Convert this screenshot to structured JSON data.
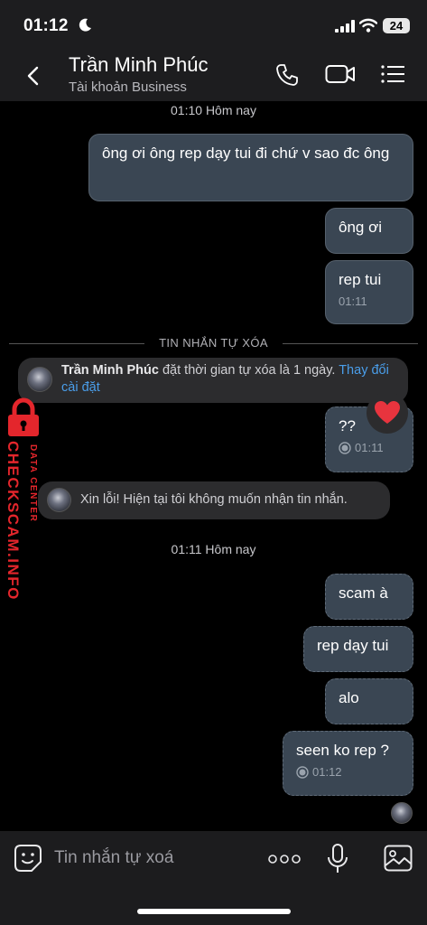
{
  "status_bar": {
    "time": "01:12",
    "battery": "24"
  },
  "header": {
    "contact_name": "Trần Minh Phúc",
    "contact_subtitle": "Tài khoản Business",
    "icons": [
      "back-icon",
      "phone-icon",
      "video-call-icon",
      "menu-icon"
    ]
  },
  "chat": {
    "timestamp_1": "01:10 Hôm nay",
    "messages_1": [
      {
        "text": "ông ơi ông rep dạy tui đi chứ v sao đc ông"
      },
      {
        "text": "ông ơi"
      },
      {
        "text": "rep tui",
        "time": "01:11"
      }
    ],
    "divider_label": "TIN NHẮN TỰ XÓA",
    "system_timer": {
      "name": "Trần Minh Phúc",
      "text": " đặt thời gian tự xóa là 1 ngày. ",
      "link": "Thay đổi cài đặt"
    },
    "message_qq": {
      "text": "??",
      "time": "01:11",
      "reaction": "heart"
    },
    "auto_reply": "Xin lỗi! Hiện tại tôi không muốn nhận tin nhắn.",
    "timestamp_2": "01:11 Hôm nay",
    "messages_2": [
      {
        "text": "scam à"
      },
      {
        "text": "rep dạy tui"
      },
      {
        "text": "alo"
      },
      {
        "text": "seen ko rep ?",
        "time": "01:12"
      }
    ]
  },
  "watermark": {
    "main": "CHECKSCAM.INFO",
    "sub": "DATA CENTER",
    "color": "#e4262c"
  },
  "input_bar": {
    "placeholder": "Tin nhắn tự xoá"
  },
  "colors": {
    "bubble": "#3a4653",
    "link": "#4a9eea",
    "header_bg": "#1d1d1f"
  }
}
